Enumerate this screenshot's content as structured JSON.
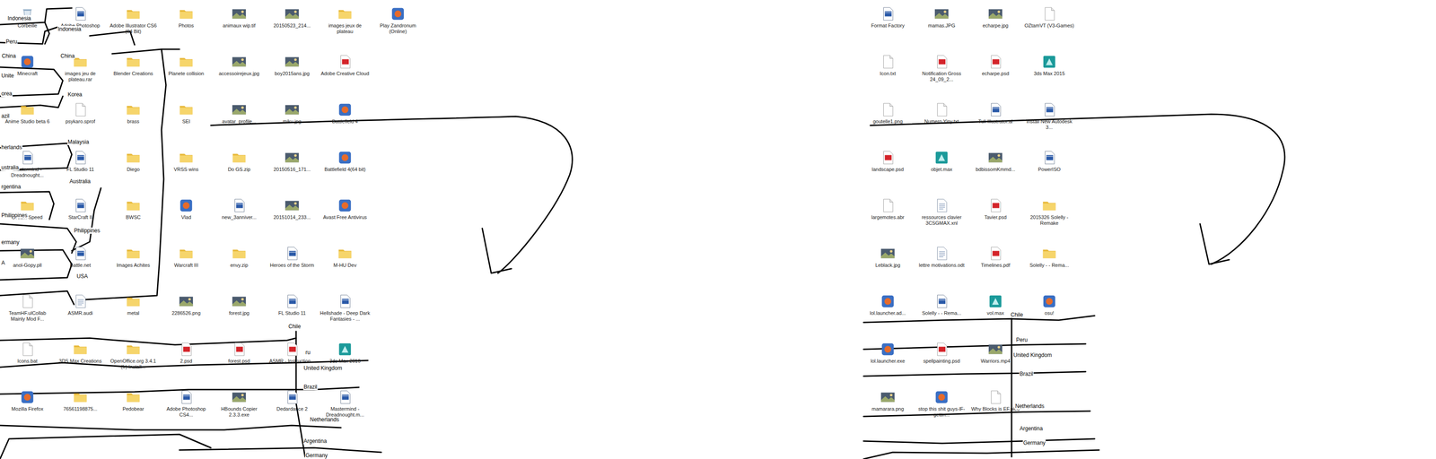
{
  "left_icons": [
    [
      {
        "label": "Corbeille",
        "kind": "bin"
      },
      {
        "label": "Adobe Photoshop",
        "kind": "exe"
      },
      {
        "label": "Adobe Illustrator CS6 (64 Bit)",
        "kind": "folder"
      },
      {
        "label": "Photos",
        "kind": "folder"
      },
      {
        "label": "animaux wip.tif",
        "kind": "image"
      },
      {
        "label": "20150523_214...",
        "kind": "image"
      },
      {
        "label": "images jeux de plateau",
        "kind": "folder"
      },
      {
        "label": "Play Zandronum (Online)",
        "kind": "app"
      }
    ],
    [
      {
        "label": "Minecraft",
        "kind": "app"
      },
      {
        "label": "images jeu de plateau.rar",
        "kind": "folder"
      },
      {
        "label": "Blender Creations",
        "kind": "folder"
      },
      {
        "label": "Planete collision",
        "kind": "folder"
      },
      {
        "label": "accessoirejeux.jpg",
        "kind": "image"
      },
      {
        "label": "boy2015ans.jpg",
        "kind": "image"
      },
      {
        "label": "Adobe Creative Cloud",
        "kind": "pdf"
      }
    ],
    [
      {
        "label": "Anime Studio beta 6",
        "kind": "folder"
      },
      {
        "label": "psykaro.sprof",
        "kind": "file"
      },
      {
        "label": "brass",
        "kind": "folder"
      },
      {
        "label": "SEI",
        "kind": "folder"
      },
      {
        "label": "avatar_profile...",
        "kind": "image"
      },
      {
        "label": "miku.jpg",
        "kind": "image"
      },
      {
        "label": "Battlefield 4",
        "kind": "app"
      }
    ],
    [
      {
        "label": "Mastermind - Dreadnought...",
        "kind": "exe"
      },
      {
        "label": "FL Studio 11",
        "kind": "exe"
      },
      {
        "label": "Diego",
        "kind": "folder"
      },
      {
        "label": "VRSS wins",
        "kind": "folder"
      },
      {
        "label": "Do GS.zip",
        "kind": "folder"
      },
      {
        "label": "20150516_171...",
        "kind": "image"
      },
      {
        "label": "Battlefield 4(64 bit)",
        "kind": "app"
      }
    ],
    [
      {
        "label": "Dream Speed",
        "kind": "folder"
      },
      {
        "label": "StarCraft II",
        "kind": "exe"
      },
      {
        "label": "BWSC",
        "kind": "folder"
      },
      {
        "label": "Vlad",
        "kind": "app"
      },
      {
        "label": "new_3anniver...",
        "kind": "exe"
      },
      {
        "label": "20151014_233...",
        "kind": "image"
      },
      {
        "label": "Avast Free Antivirus",
        "kind": "app"
      }
    ],
    [
      {
        "label": "anol-Gopy.pll",
        "kind": "image"
      },
      {
        "label": "Battle.net",
        "kind": "exe"
      },
      {
        "label": "Images Achites",
        "kind": "folder"
      },
      {
        "label": "Warcraft III",
        "kind": "folder"
      },
      {
        "label": "envy.zip",
        "kind": "folder"
      },
      {
        "label": "Heroes of the Storm",
        "kind": "exe"
      },
      {
        "label": "M-HU Dev",
        "kind": "folder"
      }
    ],
    [
      {
        "label": "TeamHF.ulCollab Mainly Mod F...",
        "kind": "file"
      },
      {
        "label": "ASMR.audi",
        "kind": "text"
      },
      {
        "label": "metal",
        "kind": "folder"
      },
      {
        "label": "2286526.png",
        "kind": "image"
      },
      {
        "label": "forest.jpg",
        "kind": "image"
      },
      {
        "label": "FL Studio 11",
        "kind": "exe"
      },
      {
        "label": "Hellshade - Deep Dark Fantasies - ...",
        "kind": "exe"
      }
    ],
    [
      {
        "label": "Icons.bat",
        "kind": "file"
      },
      {
        "label": "3DS Max Creations",
        "kind": "folder"
      },
      {
        "label": "OpenOffice.org 3.4.1 (fr) Install...",
        "kind": "folder"
      },
      {
        "label": "2.psd",
        "kind": "pdf"
      },
      {
        "label": "forest.psd",
        "kind": "pdf"
      },
      {
        "label": "ASMR - Instruction...",
        "kind": "pdf"
      },
      {
        "label": "3ds Max 2016",
        "kind": "max"
      }
    ],
    [
      {
        "label": "Mozilla Firefox",
        "kind": "app"
      },
      {
        "label": "76561198875...",
        "kind": "folder"
      },
      {
        "label": "Pedobear",
        "kind": "folder"
      },
      {
        "label": "Adobe Photoshop CS4...",
        "kind": "exe"
      },
      {
        "label": "HBounds Copier 2.3.3.exe",
        "kind": "image"
      },
      {
        "label": "Dedardance 2",
        "kind": "exe"
      },
      {
        "label": "Mastermind - Dreadnought.m...",
        "kind": "exe"
      }
    ]
  ],
  "right_icons": [
    [
      {
        "label": "Format Factory",
        "kind": "exe"
      },
      {
        "label": "mamas.JPG",
        "kind": "image"
      },
      {
        "label": "echarpe.jpg",
        "kind": "image"
      },
      {
        "label": "OZtamVT (V3-Games)",
        "kind": "file"
      }
    ],
    [
      {
        "label": "Icon.txt",
        "kind": "file"
      },
      {
        "label": "Notification Gross 24_09_2...",
        "kind": "pdf"
      },
      {
        "label": "echarpe.psd",
        "kind": "pdf"
      },
      {
        "label": "3ds Max 2015",
        "kind": "max"
      }
    ],
    [
      {
        "label": "goutelle1.png",
        "kind": "file"
      },
      {
        "label": "Numero Yiny.txt",
        "kind": "file"
      },
      {
        "label": "Tuli Illustrator.ai",
        "kind": "exe"
      },
      {
        "label": "Install New Autodesk 3...",
        "kind": "exe"
      }
    ],
    [
      {
        "label": "landscape.psd",
        "kind": "pdf"
      },
      {
        "label": "objet.max",
        "kind": "max"
      },
      {
        "label": "bdbissomKmmd...",
        "kind": "image"
      },
      {
        "label": "PowerISO",
        "kind": "exe"
      }
    ],
    [
      {
        "label": "largemotes.abr",
        "kind": "file"
      },
      {
        "label": "ressources clavier 3CSGMAX.xnl",
        "kind": "text"
      },
      {
        "label": "Tavier.psd",
        "kind": "pdf"
      },
      {
        "label": "2015326 Solelly - Remake",
        "kind": "folder"
      }
    ],
    [
      {
        "label": "Leblack.jpg",
        "kind": "image"
      },
      {
        "label": "lettre motivations.odt",
        "kind": "text"
      },
      {
        "label": "Timelines.pdf",
        "kind": "pdf"
      },
      {
        "label": "Solelly - - Rema...",
        "kind": "folder"
      }
    ],
    [
      {
        "label": "lol.launcher.ad...",
        "kind": "app"
      },
      {
        "label": "Solelly - - Rema...",
        "kind": "exe"
      },
      {
        "label": "vol.max",
        "kind": "max"
      },
      {
        "label": "osu!",
        "kind": "app"
      }
    ],
    [
      {
        "label": "lol.launcher.exe",
        "kind": "app"
      },
      {
        "label": "spellpainting.psd",
        "kind": "pdf"
      },
      {
        "label": "Warriors.mp4",
        "kind": "image"
      }
    ],
    [
      {
        "label": "mamarara.png",
        "kind": "image"
      },
      {
        "label": "stop this shit guys-lF-gettin...",
        "kind": "app"
      },
      {
        "label": "Why Blocks is EF.pieo",
        "kind": "file"
      }
    ]
  ],
  "left_labels": [
    "Indonesia",
    "Indonesia",
    "Peru",
    "China",
    "China",
    "Unite",
    "orea",
    "Korea",
    "azil",
    "Malaysia",
    "herlands",
    "ustralia",
    "Australia",
    "rgentina",
    "Philippines",
    "Philippines",
    "ermany",
    "A",
    "USA",
    "Chile",
    "ru",
    "United Kingdom",
    "Brazil",
    "Netherlands",
    "Argentina",
    "Germany"
  ],
  "right_labels": [
    "Chile",
    "Peru",
    "United Kingdom",
    "Brazil",
    "Netherlands",
    "Argentina",
    "Germany"
  ]
}
